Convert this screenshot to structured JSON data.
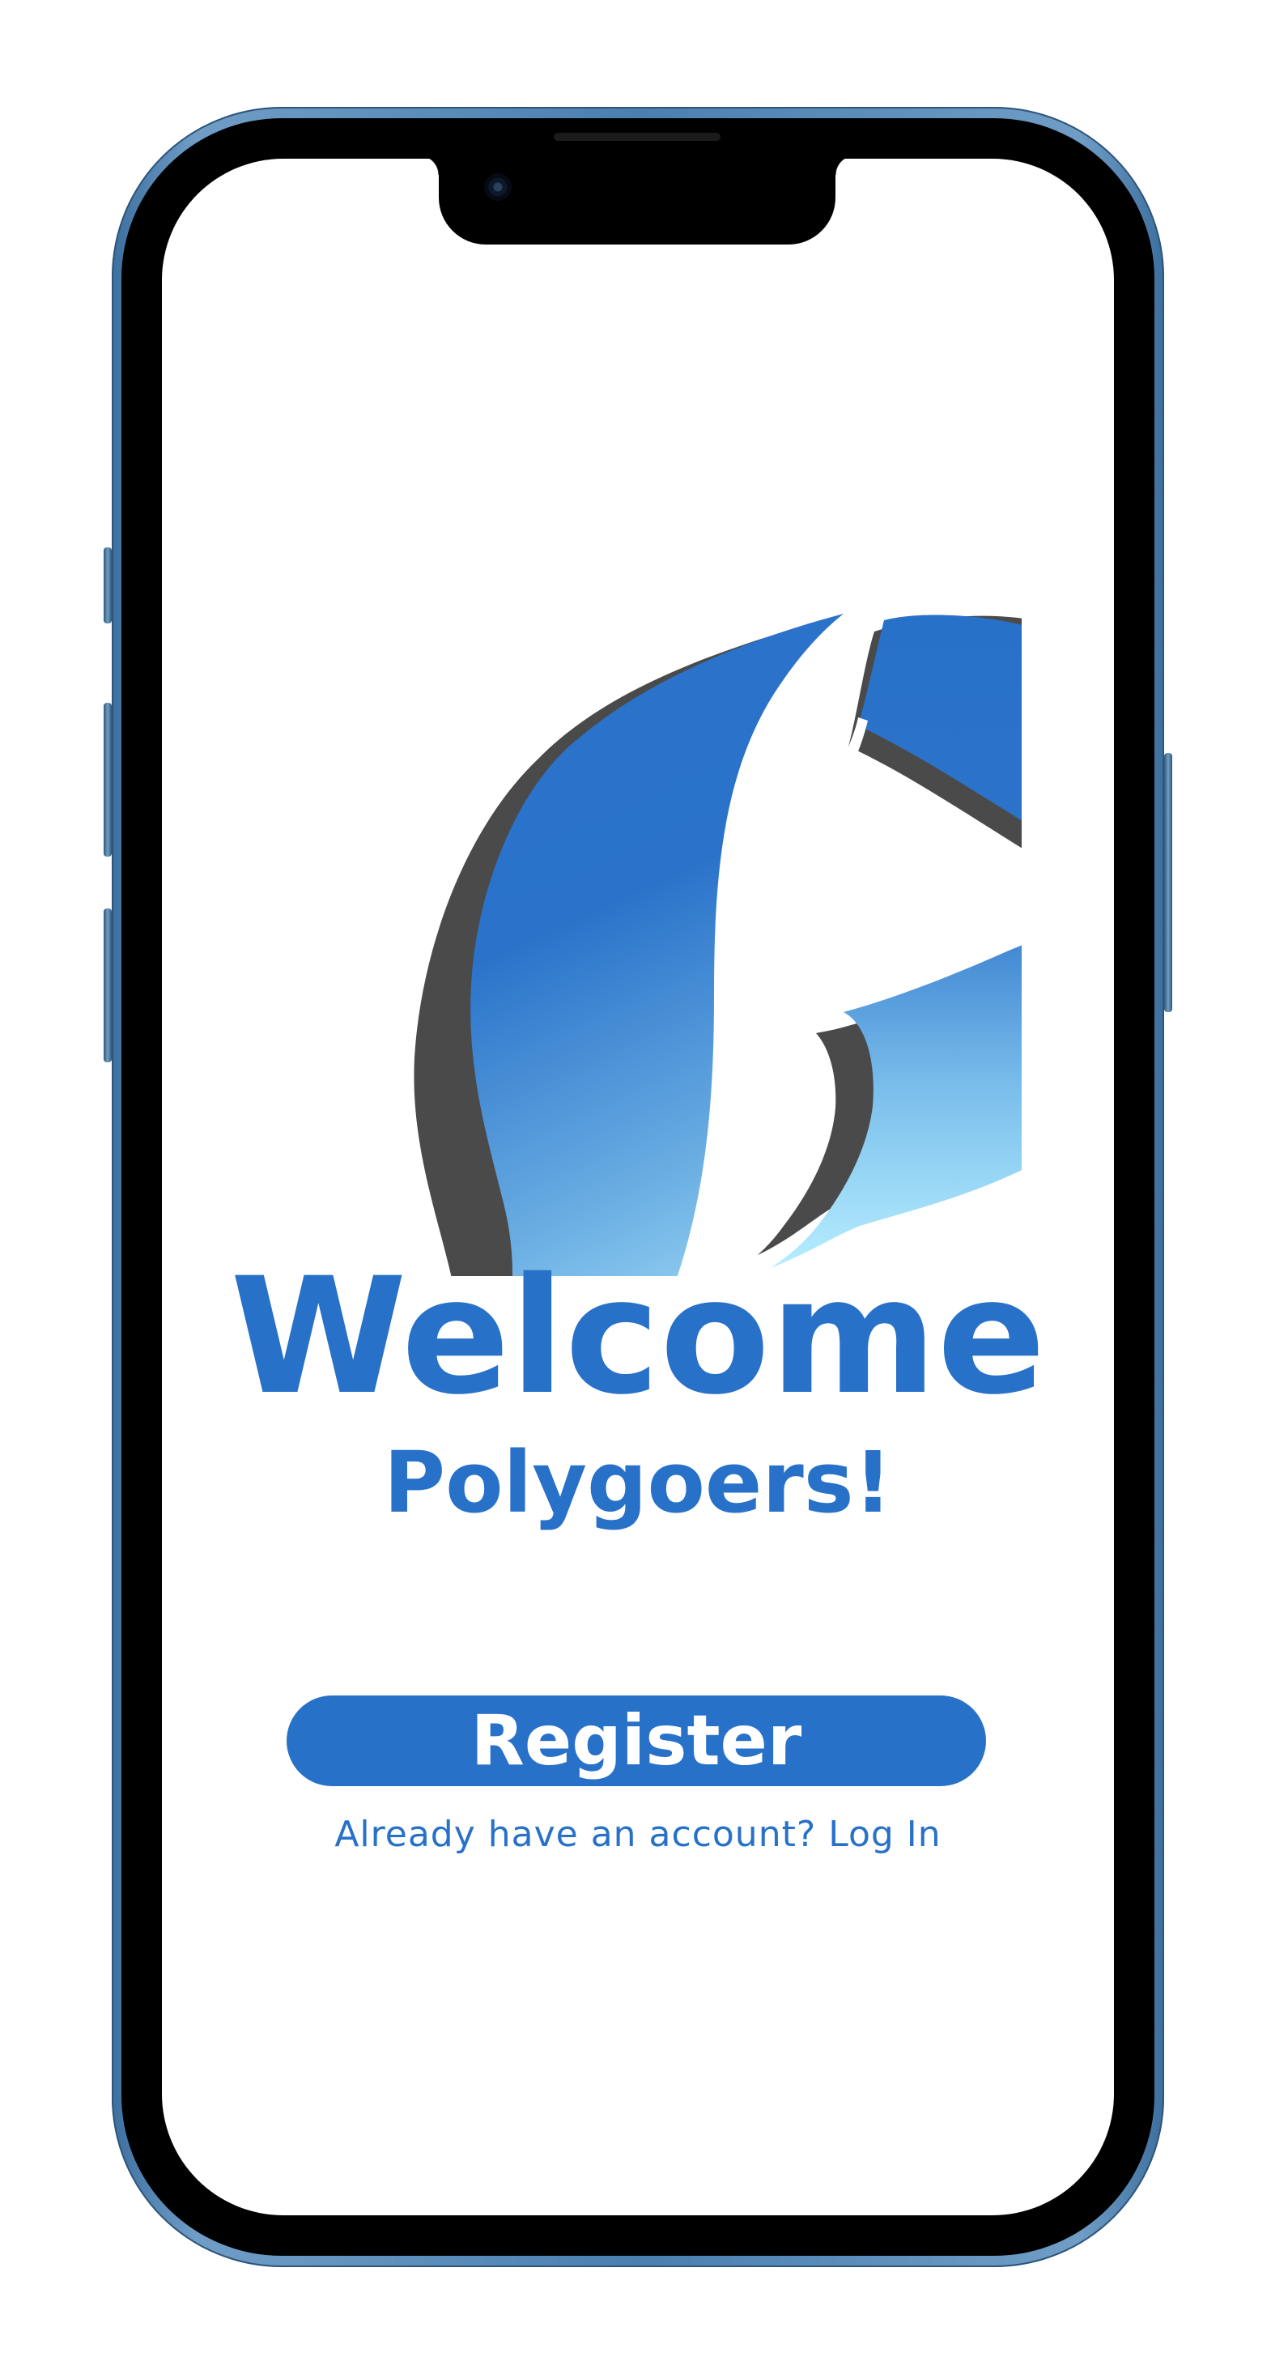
{
  "welcome_screen": {
    "title": "Welcome",
    "subtitle": "Polygoers!",
    "register_label": "Register",
    "login_prompt": "Already have an account?",
    "login_link": "Log In"
  },
  "colors": {
    "brand_blue": "#2871c9",
    "light_blue": "#b3ecff",
    "logo_shadow": "#4a4a4a",
    "screen_background": "#ffffff"
  },
  "icons": {
    "logo": "polygoers-p-logo-icon"
  }
}
